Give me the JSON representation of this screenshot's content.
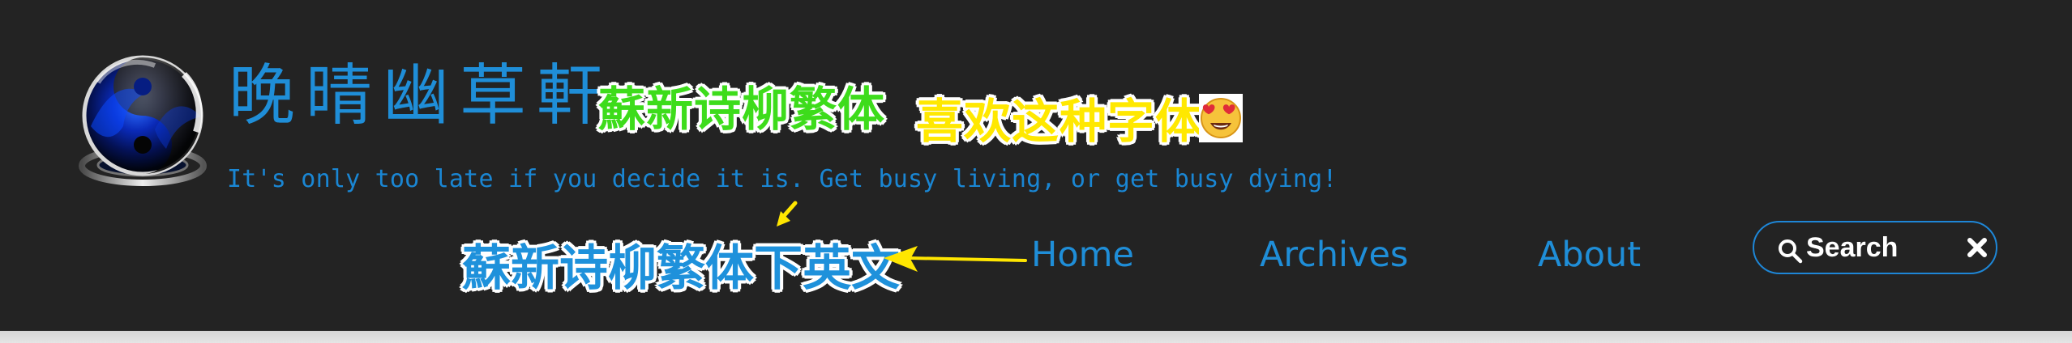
{
  "header": {
    "site_title": "晚晴幽草軒",
    "subtitle": "It's only too late if you decide it is. Get busy living, or get busy dying!"
  },
  "annotations": {
    "title_font": "蘇新诗柳繁体",
    "preference": "喜欢这种字体",
    "subtitle_font": "蘇新诗柳繁体下英文",
    "emoji": "heart-eyes-emoji",
    "arrow_color": "#ffe600"
  },
  "nav": {
    "items": [
      {
        "label": "Home"
      },
      {
        "label": "Archives"
      },
      {
        "label": "About"
      }
    ]
  },
  "search": {
    "placeholder": "Search",
    "icon": "search-icon",
    "clear_icon": "close-icon"
  },
  "colors": {
    "background": "#232323",
    "accent": "#1f8ed8",
    "green_annotation": "#3ddc1b",
    "yellow_annotation": "#ffe800",
    "white": "#ffffff"
  }
}
